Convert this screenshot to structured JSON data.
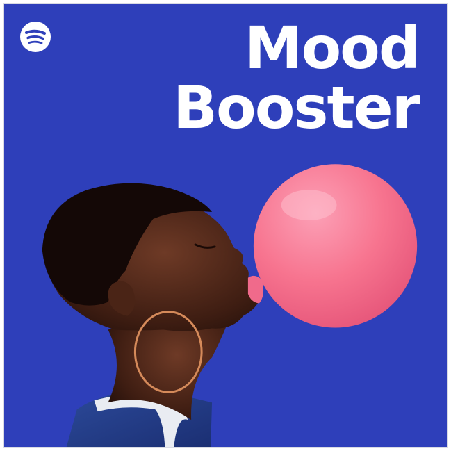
{
  "playlist": {
    "title_line1": "Mood",
    "title_line2": "Booster",
    "brand_icon": "spotify-logo-icon"
  },
  "colors": {
    "background": "#2e3fba",
    "title_text": "#ffffff",
    "logo": "#ffffff",
    "balloon": "#f77796"
  }
}
